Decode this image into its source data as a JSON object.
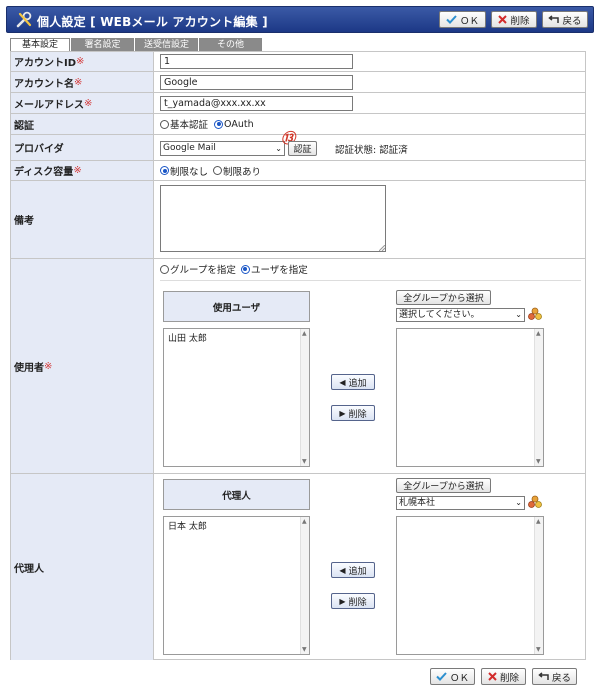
{
  "header": {
    "title": "個人設定 [ WEBメール  アカウント編集 ]",
    "ok_label": "ＯＫ",
    "delete_label": "削除",
    "back_label": "戻る"
  },
  "tabs": [
    {
      "label": "基本設定",
      "active": true
    },
    {
      "label": "署名設定",
      "active": false
    },
    {
      "label": "送受信設定",
      "active": false
    },
    {
      "label": "その他",
      "active": false
    }
  ],
  "form": {
    "account_id": {
      "label": "アカウントID",
      "required_mark": "※",
      "value": "1"
    },
    "account_name": {
      "label": "アカウント名",
      "required_mark": "※",
      "value": "Google"
    },
    "email": {
      "label": "メールアドレス",
      "required_mark": "※",
      "value": "t_yamada@xxx.xx.xx"
    },
    "auth": {
      "label": "認証",
      "option_basic": "基本認証",
      "option_oauth": "OAuth",
      "selected": "OAuth"
    },
    "provider": {
      "label": "プロバイダ",
      "selected": "Google Mail",
      "auth_button": "認証",
      "status": "認証状態: 認証済",
      "callout": "⑬"
    },
    "disk": {
      "label": "ディスク容量",
      "required_mark": "※",
      "option_unlimited": "制限なし",
      "option_limited": "制限あり",
      "selected": "制限なし"
    },
    "note": {
      "label": "備考",
      "value": ""
    },
    "users": {
      "label": "使用者",
      "required_mark": "※",
      "option_group": "グループを指定",
      "option_user": "ユーザを指定",
      "selected": "ユーザを指定",
      "list_header": "使用ユーザ",
      "items": [
        "山田 太郎"
      ],
      "all_groups_button": "全グループから選択",
      "group_select": "選択してください。",
      "add_button": "追加",
      "remove_button": "削除"
    },
    "proxy": {
      "label": "代理人",
      "list_header": "代理人",
      "items": [
        "日本 太郎"
      ],
      "all_groups_button": "全グループから選択",
      "group_select": "札幌本社",
      "add_button": "追加",
      "remove_button": "削除"
    }
  },
  "footer": {
    "ok_label": "ＯＫ",
    "delete_label": "削除",
    "back_label": "戻る"
  }
}
